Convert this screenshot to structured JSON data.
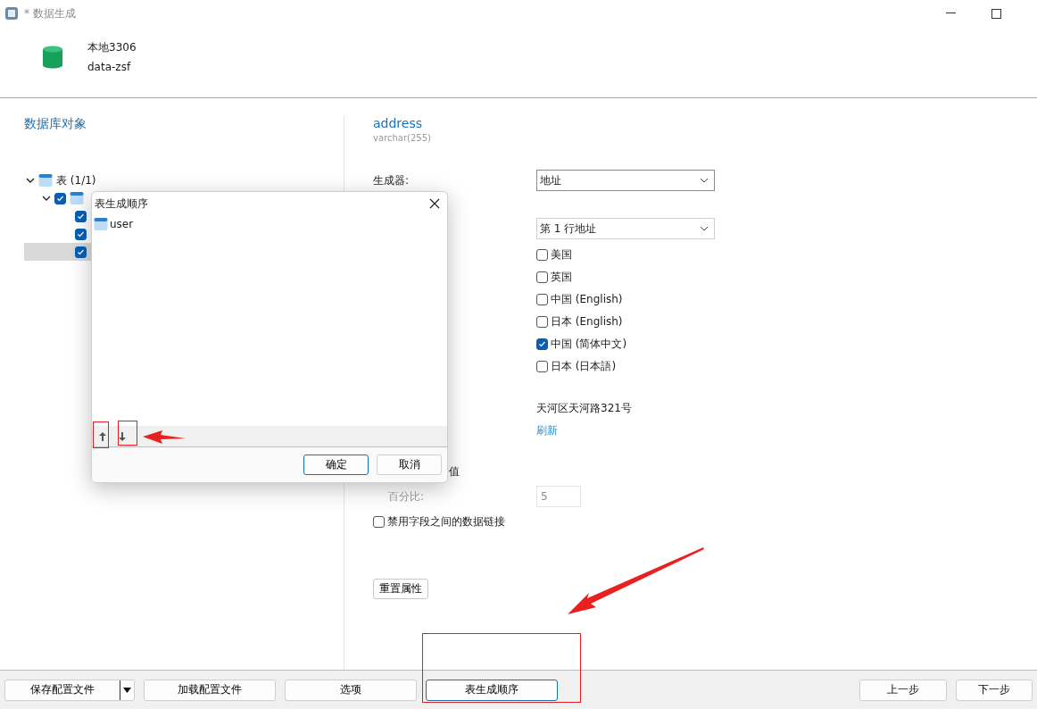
{
  "window": {
    "title": "* 数据生成"
  },
  "connection": {
    "name": "本地3306",
    "database": "data-zsf"
  },
  "objects_panel": {
    "title": "数据库对象",
    "tree": [
      {
        "label": "表 (1/1)",
        "expanded": true,
        "children": [
          {
            "checked": true,
            "expanded": true,
            "selected": false,
            "children": [
              {
                "checked": true,
                "selected": false
              },
              {
                "checked": true,
                "selected": false
              },
              {
                "checked": true,
                "selected": true
              }
            ]
          }
        ]
      }
    ]
  },
  "field": {
    "name": "address",
    "type": "varchar(255)",
    "generator_label": "生成器:",
    "generator": "地址",
    "format": "第 1 行地址",
    "options": [
      {
        "label": "美国",
        "checked": false
      },
      {
        "label": "英国",
        "checked": false
      },
      {
        "label": "中国 (English)",
        "checked": false
      },
      {
        "label": "日本 (English)",
        "checked": false
      },
      {
        "label": "中国 (简体中文)",
        "checked": true
      },
      {
        "label": "日本 (日本語)",
        "checked": false
      }
    ],
    "preview": "天河区天河路321号",
    "refresh": "刷新",
    "null_label_tail": "值",
    "percent_label": "百分比:",
    "percent": "5",
    "disable_link": {
      "label": "禁用字段之间的数据链接",
      "checked": false
    },
    "reset": "重置属性"
  },
  "dialog": {
    "title": "表生成顺序",
    "items": [
      {
        "label": "user",
        "selected": false
      }
    ],
    "buttons": [
      {
        "label": "确定",
        "default": true
      },
      {
        "label": "取消",
        "default": false
      }
    ]
  },
  "footer": {
    "left": [
      {
        "label": "保存配置文件",
        "dropdown": true,
        "focused": false
      },
      {
        "label": "加载配置文件",
        "dropdown": false,
        "focused": false
      },
      {
        "label": "选项",
        "dropdown": false,
        "focused": false
      },
      {
        "label": "表生成顺序",
        "dropdown": false,
        "focused": true
      }
    ],
    "right": [
      {
        "label": "上一步",
        "focused": false
      },
      {
        "label": "下一步",
        "focused": false
      }
    ]
  }
}
